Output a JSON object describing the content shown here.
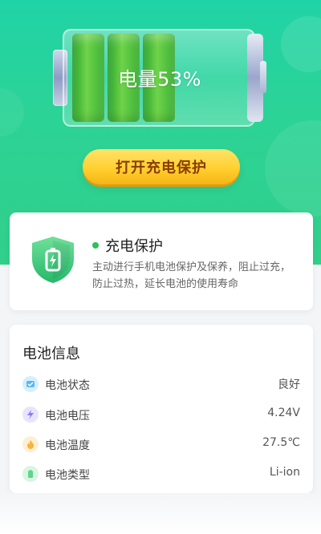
{
  "battery": {
    "label": "电量53%",
    "level_percent": 53
  },
  "cta": {
    "label": "打开充电保护"
  },
  "protect_card": {
    "title": "充电保护",
    "description": "主动进行手机电池保护及保养，阻止过充，防止过热，延长电池的使用寿命"
  },
  "info_card": {
    "title": "电池信息",
    "rows": [
      {
        "label": "电池状态",
        "value": "良好",
        "icon": "status-icon",
        "color": "#56b9f4"
      },
      {
        "label": "电池电压",
        "value": "4.24V",
        "icon": "voltage-icon",
        "color": "#8b7bf2"
      },
      {
        "label": "电池温度",
        "value": "27.5℃",
        "icon": "temperature-icon",
        "color": "#f6b43a"
      },
      {
        "label": "电池类型",
        "value": "Li-ion",
        "icon": "battery-type-icon",
        "color": "#62d48a"
      }
    ]
  },
  "colors": {
    "hero_green": "#2cd396",
    "cta_yellow": "#ffd02f",
    "accent_dot": "#2fbf5b"
  }
}
